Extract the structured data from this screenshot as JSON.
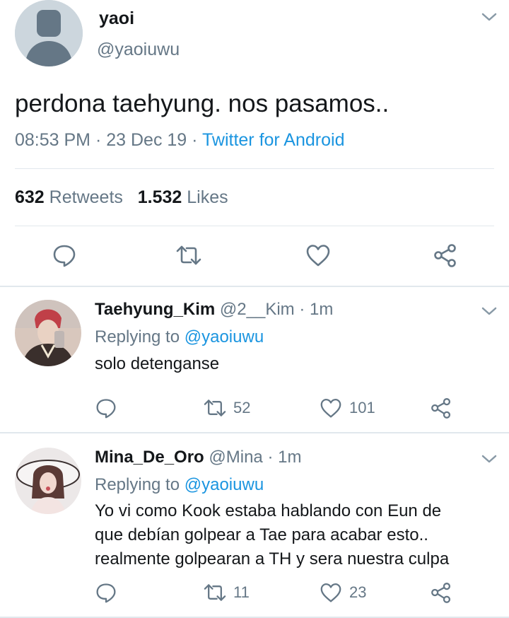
{
  "main_tweet": {
    "author_name": "yaoi",
    "author_handle": "@yaoiuwu",
    "text": "perdona taehyung. nos pasamos..",
    "time": "08:53 PM",
    "dot": "·",
    "date": "23 Dec 19",
    "source": "Twitter for Android",
    "retweet_count": "632",
    "retweets_label": "Retweets",
    "like_count": "1.532",
    "likes_label": "Likes",
    "actions": [
      "reply-icon",
      "retweet-icon",
      "like-icon",
      "share-icon"
    ]
  },
  "replies": [
    {
      "name": "Taehyung_Kim",
      "handle": "@2__Kim",
      "dot": "·",
      "time": "1m",
      "replying_prefix": "Replying to",
      "replying_to": "@yaoiuwu",
      "text_lines": [
        "solo detenganse"
      ],
      "retweets": "52",
      "likes": "101"
    },
    {
      "name": "Mina_De_Oro",
      "handle": "@Mina",
      "dot": "·",
      "time": "1m",
      "replying_prefix": "Replying to",
      "replying_to": "@yaoiuwu",
      "text_lines": [
        "Yo vi como Kook estaba hablando con Eun de",
        "que debían golpear a Tae para acabar esto..",
        "realmente golpearan a TH y sera nuestra culpa"
      ],
      "retweets": "11",
      "likes": "23"
    }
  ],
  "colors": {
    "link": "#1b95e0",
    "secondary_text": "#657786",
    "primary_text": "#14171a",
    "divider": "#e1e8ed"
  }
}
